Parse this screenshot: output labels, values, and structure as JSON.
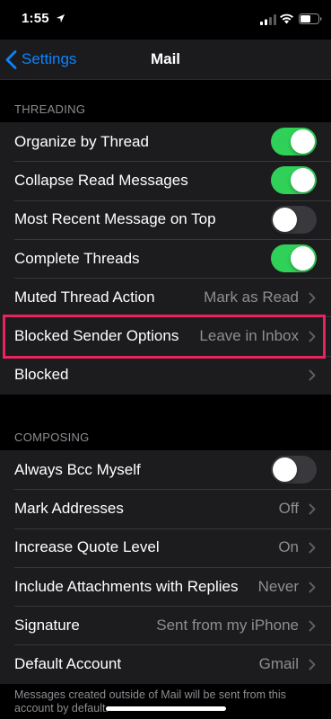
{
  "status_bar": {
    "time": "1:55"
  },
  "nav": {
    "back_label": "Settings",
    "title": "Mail"
  },
  "threading": {
    "header": "THREADING",
    "rows": [
      {
        "label": "Organize by Thread",
        "toggle": true
      },
      {
        "label": "Collapse Read Messages",
        "toggle": true
      },
      {
        "label": "Most Recent Message on Top",
        "toggle": false
      },
      {
        "label": "Complete Threads",
        "toggle": true
      },
      {
        "label": "Muted Thread Action",
        "value": "Mark as Read"
      },
      {
        "label": "Blocked Sender Options",
        "value": "Leave in Inbox"
      },
      {
        "label": "Blocked",
        "value": ""
      }
    ]
  },
  "composing": {
    "header": "COMPOSING",
    "rows": [
      {
        "label": "Always Bcc Myself",
        "toggle": false
      },
      {
        "label": "Mark Addresses",
        "value": "Off"
      },
      {
        "label": "Increase Quote Level",
        "value": "On"
      },
      {
        "label": "Include Attachments with Replies",
        "value": "Never"
      },
      {
        "label": "Signature",
        "value": "Sent from my iPhone"
      },
      {
        "label": "Default Account",
        "value": "Gmail"
      }
    ],
    "footer": "Messages created outside of Mail will be sent from this account by default."
  },
  "colors": {
    "accent": "#0a84ff",
    "toggle_on": "#30d158",
    "highlight": "#e8245e"
  }
}
